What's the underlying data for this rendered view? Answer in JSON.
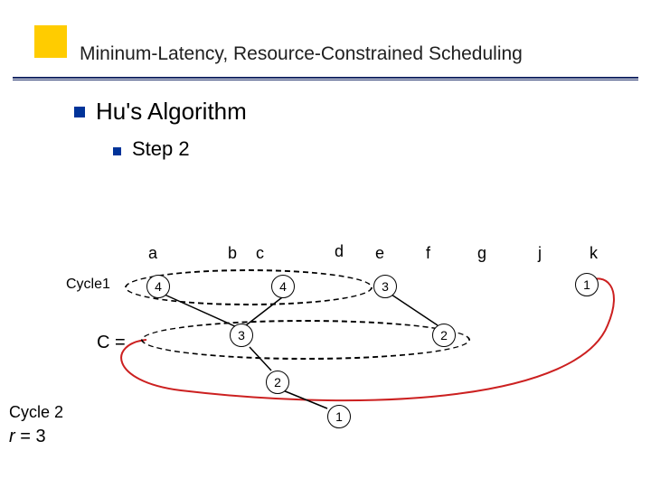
{
  "title": "Mininum-Latency, Resource-Constrained Scheduling",
  "h1": "Hu's Algorithm",
  "h2": "Step 2",
  "top_labels": {
    "a": "a",
    "b": "b",
    "c": "c",
    "d": "d",
    "e": "e",
    "f": "f",
    "g": "g",
    "j": "j",
    "k": "k"
  },
  "nodes": {
    "n_a": "4",
    "n_d": "4",
    "n_e": "3",
    "n_k": "1",
    "n_c": "3",
    "n_f": "2",
    "n_mid": "2",
    "n_bot": "1"
  },
  "side": {
    "cycle1": "Cycle1",
    "ceq": "C =",
    "cycle2": "Cycle 2",
    "r_label": "r",
    "r_eq": " = 3"
  }
}
